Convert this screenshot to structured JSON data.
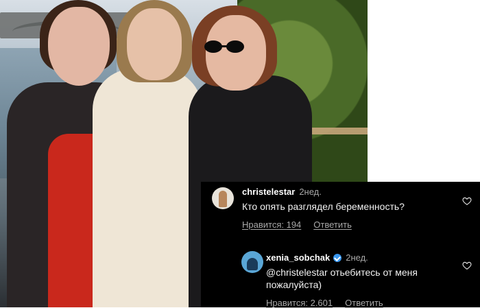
{
  "comments": [
    {
      "username": "christelestar",
      "time": "2нед.",
      "text": "Кто опять разглядел беременность?",
      "likes": "Нравится: 194",
      "reply": "Ответить"
    },
    {
      "username": "xenia_sobchak",
      "time": "2нед.",
      "verified": true,
      "text": "@christelestar отьебитесь от меня пожалуйста)",
      "likes": "Нравится: 2.601",
      "reply": "Ответить"
    }
  ],
  "icons": {
    "heart": "heart-outline-icon",
    "verified": "verified-badge-icon"
  },
  "colors": {
    "panel_bg": "#000000",
    "text": "#ffffff",
    "muted": "#a8a8a8",
    "verified": "#3897f0"
  }
}
